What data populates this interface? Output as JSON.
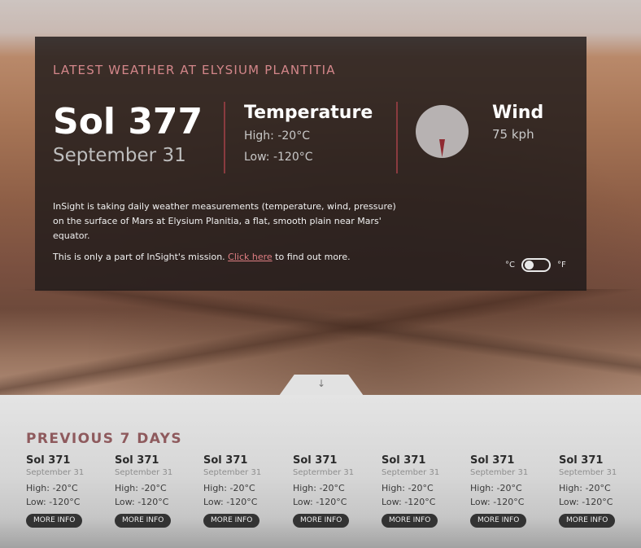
{
  "current": {
    "heading": "LATEST WEATHER AT ELYSIUM PLANTITIA",
    "sol": "Sol 377",
    "date": "September 31",
    "temperature_title": "Temperature",
    "temp_high": "High: -20°C",
    "temp_low": "Low: -120°C",
    "wind_title": "Wind",
    "wind_speed": "75 kph",
    "description": "InSight is taking daily weather measurements (temperature, wind, pressure) on the surface of Mars at Elysium Planitia, a flat, smooth plain near Mars' equator.",
    "mission_prefix": "This is only a part of InSight's mission. ",
    "mission_link": "Click here",
    "mission_suffix": " to find out more.",
    "unit_c": "°C",
    "unit_f": "°F",
    "unit_selected": "°C"
  },
  "icons": {
    "compass": "compass-icon",
    "toggle_arrow": "arrow-down-icon",
    "toggle_arrow_glyph": "↓"
  },
  "colors": {
    "accent": "#d3868a",
    "needle": "#8f2a31",
    "divider": "#8a3b3f"
  },
  "previous": {
    "heading": "PREVIOUS 7 DAYS",
    "days": [
      {
        "sol": "Sol 371",
        "date": "September 31",
        "high": "High: -20°C",
        "low": "Low: -120°C",
        "button": "MORE INFO"
      },
      {
        "sol": "Sol 371",
        "date": "September 31",
        "high": "High: -20°C",
        "low": "Low: -120°C",
        "button": "MORE INFO"
      },
      {
        "sol": "Sol 371",
        "date": "September 31",
        "high": "High: -20°C",
        "low": "Low: -120°C",
        "button": "MORE INFO"
      },
      {
        "sol": "Sol 371",
        "date": "Septermber 31",
        "high": "High: -20°C",
        "low": "Low: -120°C",
        "button": "MORE INFO"
      },
      {
        "sol": "Sol 371",
        "date": "September 31",
        "high": "High: -20°C",
        "low": "Low: -120°C",
        "button": "MORE INFO"
      },
      {
        "sol": "Sol 371",
        "date": "September 31",
        "high": "High: -20°C",
        "low": "Low: -120°C",
        "button": "MORE INFO"
      },
      {
        "sol": "Sol 371",
        "date": "September 31",
        "high": "High: -20°C",
        "low": "Low: -120°C",
        "button": "MORE INFO"
      }
    ]
  }
}
